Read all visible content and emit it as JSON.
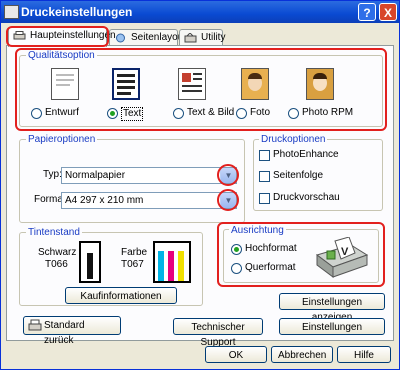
{
  "window": {
    "title": "Druckeinstellungen",
    "help": "?",
    "close": "X"
  },
  "tabs": [
    {
      "label": "Haupteinstellungen"
    },
    {
      "label": "Seitenlayout"
    },
    {
      "label": "Utility"
    }
  ],
  "quality": {
    "label": "Qualitätsoption",
    "options": [
      {
        "label": "Entwurf",
        "selected": false,
        "icon": "draft-doc-icon"
      },
      {
        "label": "Text",
        "selected": true,
        "icon": "text-doc-icon"
      },
      {
        "label": "Text & Bild",
        "selected": false,
        "icon": "text-image-doc-icon"
      },
      {
        "label": "Foto",
        "selected": false,
        "icon": "photo-icon"
      },
      {
        "label": "Photo RPM",
        "selected": false,
        "icon": "photo-rpm-icon"
      }
    ]
  },
  "paper": {
    "label": "Papieroptionen",
    "type_label": "Typ:",
    "type_value": "Normalpapier",
    "format_label": "Format:",
    "format_value": "A4 297 x 210 mm"
  },
  "print_options": {
    "label": "Druckoptionen",
    "items": [
      {
        "label": "PhotoEnhance",
        "checked": false
      },
      {
        "label": "Seitenfolge",
        "checked": false
      },
      {
        "label": "Druckvorschau",
        "checked": false
      }
    ]
  },
  "ink": {
    "label": "Tintenstand",
    "black_name": "Schwarz",
    "black_code": "T066",
    "color_name": "Farbe",
    "color_code": "T067",
    "buy_button": "Kaufinformationen",
    "colors": {
      "black": "#111111",
      "cyan": "#00b4e6",
      "magenta": "#e6007e",
      "yellow": "#f0e000"
    }
  },
  "orientation": {
    "label": "Ausrichtung",
    "portrait": "Hochformat",
    "landscape": "Querformat",
    "selected": "Hochformat"
  },
  "buttons": {
    "show_settings": "Einstellungen anzeigen",
    "settings": "Einstellungen",
    "standard_back": "Standard zurück",
    "support": "Technischer Support",
    "ok": "OK",
    "cancel": "Abbrechen",
    "help": "Hilfe"
  }
}
